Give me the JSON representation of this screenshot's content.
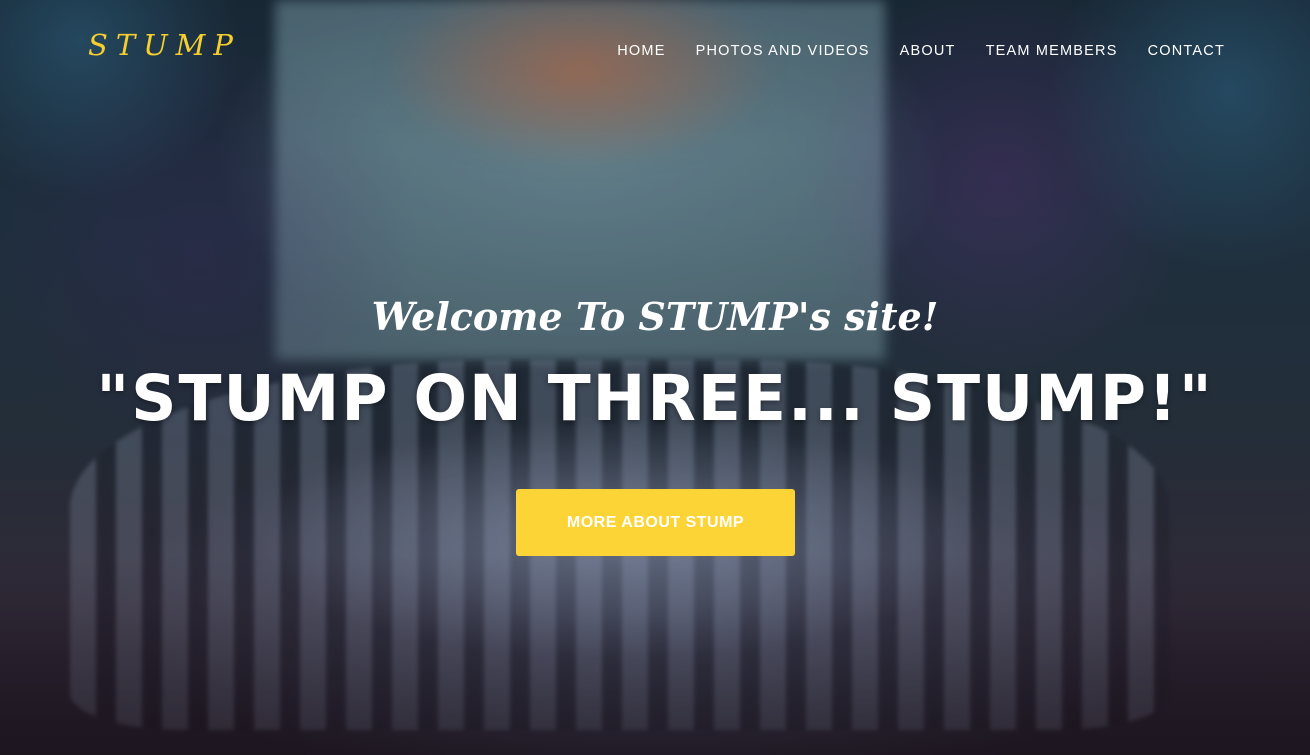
{
  "brand": {
    "logo_text": "STUMP",
    "color": "#f4cf2f"
  },
  "nav": {
    "items": [
      {
        "label": "HOME"
      },
      {
        "label": "PHOTOS AND VIDEOS"
      },
      {
        "label": "ABOUT"
      },
      {
        "label": "TEAM MEMBERS"
      },
      {
        "label": "CONTACT"
      }
    ]
  },
  "hero": {
    "welcome": "Welcome To STUMP's site!",
    "headline": "\"STUMP ON THREE... STUMP!\"",
    "cta_label": "MORE ABOUT STUMP",
    "cta_color": "#fdd436",
    "background_image": "dance-team-on-stage-photo"
  }
}
